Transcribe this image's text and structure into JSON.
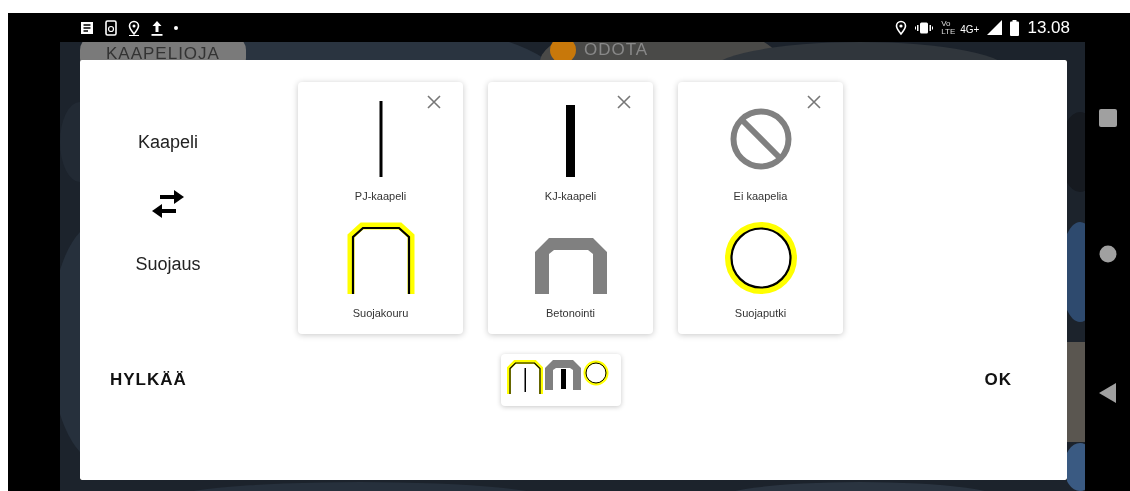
{
  "status_bar": {
    "volte": [
      "Vo",
      "LTE"
    ],
    "network": "4G+",
    "time": "13.08"
  },
  "background_chips": [
    {
      "label": "KAAPELIOJA"
    },
    {
      "label": "ODOTA",
      "color": "#c8780a"
    }
  ],
  "dialog": {
    "left": {
      "top_label": "Kaapeli",
      "bottom_label": "Suojaus"
    },
    "cards": [
      {
        "cable": {
          "kind": "thin",
          "label": "PJ-kaapeli"
        },
        "protection": {
          "kind": "channel",
          "label": "Suojakouru"
        }
      },
      {
        "cable": {
          "kind": "thick",
          "label": "KJ-kaapeli"
        },
        "protection": {
          "kind": "concrete",
          "label": "Betonointi"
        }
      },
      {
        "cable": {
          "kind": "none",
          "label": "Ei kaapelia"
        },
        "protection": {
          "kind": "pipe",
          "label": "Suojaputki"
        }
      }
    ],
    "cancel_button": "HYLKÄÄ",
    "ok_button": "OK"
  }
}
